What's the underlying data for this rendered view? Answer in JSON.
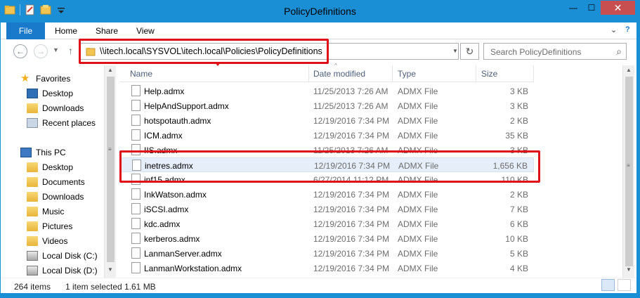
{
  "window": {
    "title": "PolicyDefinitions",
    "min_label": "—",
    "max_label": "☐",
    "close_label": "✕"
  },
  "ribbon": {
    "file_tab": "File",
    "tabs": [
      "Home",
      "Share",
      "View"
    ],
    "expand_glyph": "⌄",
    "help_glyph": "?"
  },
  "address": {
    "back_glyph": "←",
    "forward_glyph": "→",
    "up_glyph": "↑",
    "path": "\\\\itech.local\\SYSVOL\\itech.local\\Policies\\PolicyDefinitions",
    "refresh_glyph": "↻",
    "search_placeholder": "Search PolicyDefinitions"
  },
  "nav": {
    "favorites": "Favorites",
    "fav_items": [
      "Desktop",
      "Downloads",
      "Recent places"
    ],
    "this_pc": "This PC",
    "pc_items": [
      "Desktop",
      "Documents",
      "Downloads",
      "Music",
      "Pictures",
      "Videos",
      "Local Disk (C:)",
      "Local Disk (D:)"
    ]
  },
  "columns": {
    "name": "Name",
    "date": "Date modified",
    "type": "Type",
    "size": "Size"
  },
  "files": [
    {
      "name": "Help.admx",
      "date": "11/25/2013 7:26 AM",
      "type": "ADMX File",
      "size": "3 KB"
    },
    {
      "name": "HelpAndSupport.admx",
      "date": "11/25/2013 7:26 AM",
      "type": "ADMX File",
      "size": "3 KB"
    },
    {
      "name": "hotspotauth.admx",
      "date": "12/19/2016 7:34 PM",
      "type": "ADMX File",
      "size": "2 KB"
    },
    {
      "name": "ICM.admx",
      "date": "12/19/2016 7:34 PM",
      "type": "ADMX File",
      "size": "35 KB"
    },
    {
      "name": "IIS.admx",
      "date": "11/25/2013 7:26 AM",
      "type": "ADMX File",
      "size": "3 KB"
    },
    {
      "name": "inetres.admx",
      "date": "12/19/2016 7:34 PM",
      "type": "ADMX File",
      "size": "1,656 KB",
      "selected": true
    },
    {
      "name": "inf15.admx",
      "date": "6/27/2014 11:12 PM",
      "type": "ADMX File",
      "size": "110 KB"
    },
    {
      "name": "InkWatson.admx",
      "date": "12/19/2016 7:34 PM",
      "type": "ADMX File",
      "size": "2 KB"
    },
    {
      "name": "iSCSI.admx",
      "date": "12/19/2016 7:34 PM",
      "type": "ADMX File",
      "size": "7 KB"
    },
    {
      "name": "kdc.admx",
      "date": "12/19/2016 7:34 PM",
      "type": "ADMX File",
      "size": "6 KB"
    },
    {
      "name": "kerberos.admx",
      "date": "12/19/2016 7:34 PM",
      "type": "ADMX File",
      "size": "10 KB"
    },
    {
      "name": "LanmanServer.admx",
      "date": "12/19/2016 7:34 PM",
      "type": "ADMX File",
      "size": "5 KB"
    },
    {
      "name": "LanmanWorkstation.admx",
      "date": "12/19/2016 7:34 PM",
      "type": "ADMX File",
      "size": "4 KB"
    }
  ],
  "status": {
    "count": "264 items",
    "selected": "1 item selected",
    "size": "1.61 MB"
  },
  "colors": {
    "titlebar": "#1b8fd6",
    "file_tab": "#1979ca",
    "highlight": "#e01018",
    "selection": "#e5eef9"
  }
}
